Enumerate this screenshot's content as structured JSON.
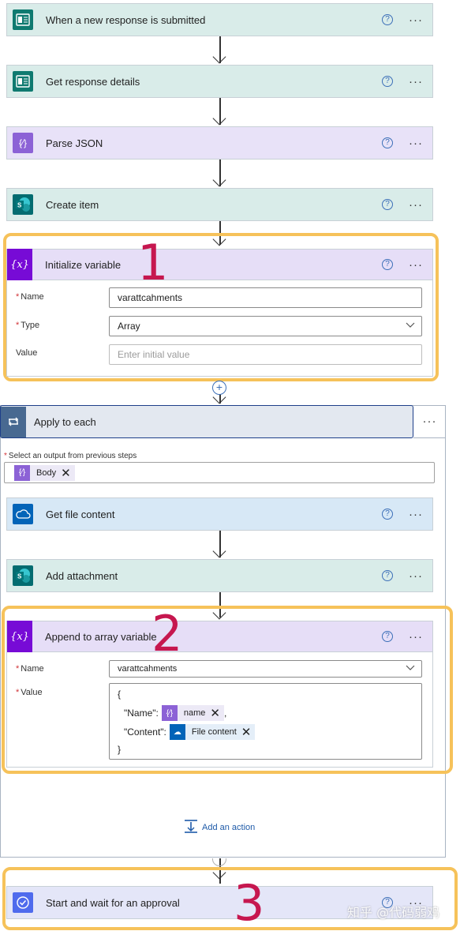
{
  "steps": {
    "s1": {
      "title": "When a new response is submitted",
      "icon": "forms-icon",
      "color": "#0f7a70"
    },
    "s2": {
      "title": "Get response details",
      "icon": "forms-icon",
      "color": "#0f7a70"
    },
    "s3": {
      "title": "Parse JSON",
      "icon": "data-operation-icon",
      "color": "#8c62d6"
    },
    "s4": {
      "title": "Create item",
      "icon": "sharepoint-icon",
      "color": "#036c70"
    },
    "s5": {
      "title": "Initialize variable",
      "icon": "variable-icon",
      "color": "#770bd6"
    },
    "s6": {
      "title": "Apply to each",
      "icon": "loop-icon",
      "color": "#486991"
    },
    "s7": {
      "title": "Get file content",
      "icon": "onedrive-icon",
      "color": "#0364b8"
    },
    "s8": {
      "title": "Add attachment",
      "icon": "sharepoint-icon",
      "color": "#036c70"
    },
    "s9": {
      "title": "Append to array variable",
      "icon": "variable-icon",
      "color": "#770bd6"
    },
    "s10": {
      "title": "Start and wait for an approval",
      "icon": "approval-icon",
      "color": "#4f6bed"
    }
  },
  "init_var": {
    "name_label": "Name",
    "name_value": "varattcahments",
    "type_label": "Type",
    "type_value": "Array",
    "value_label": "Value",
    "value_placeholder": "Enter initial value"
  },
  "apply_each": {
    "select_label": "Select an output from previous steps",
    "token": "Body"
  },
  "append": {
    "name_label": "Name",
    "name_value": "varattcahments",
    "value_label": "Value",
    "line_open": "{",
    "name_key": "\"Name\":",
    "name_token": "name",
    "content_key": "\"Content\":",
    "content_token": "File content",
    "line_close": "}"
  },
  "add_action": "Add an action",
  "help_glyph": "?",
  "more_glyph": "···",
  "annotations": [
    "1",
    "2",
    "3"
  ],
  "watermark": "知乎 @代码弱鸡",
  "colors": {
    "highlight": "#f6c25a",
    "annotation": "#c6174f",
    "required": "#d13438"
  }
}
